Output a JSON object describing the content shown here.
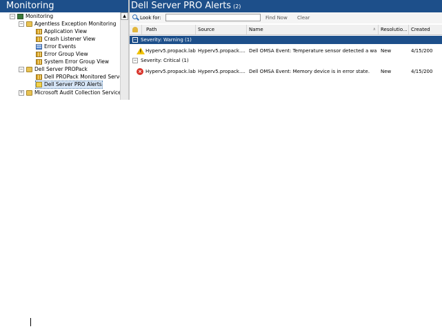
{
  "left_pane": {
    "title": "Monitoring",
    "tree": [
      {
        "label": "Monitoring",
        "indent": 0,
        "expander": "−",
        "icon": "monitor-icon"
      },
      {
        "label": "Agentless Exception Monitoring",
        "indent": 1,
        "expander": "−",
        "icon": "folder-icon"
      },
      {
        "label": "Application View",
        "indent": 2,
        "expander": "",
        "icon": "grid-icon"
      },
      {
        "label": "Crash Listener View",
        "indent": 2,
        "expander": "",
        "icon": "grid-icon"
      },
      {
        "label": "Error Events",
        "indent": 2,
        "expander": "",
        "icon": "events-icon"
      },
      {
        "label": "Error Group View",
        "indent": 2,
        "expander": "",
        "icon": "grid-icon"
      },
      {
        "label": "System Error Group View",
        "indent": 2,
        "expander": "",
        "icon": "grid-icon"
      },
      {
        "label": "Dell Server PROPack",
        "indent": 1,
        "expander": "−",
        "icon": "folder-icon"
      },
      {
        "label": "Dell PROPack Monitored Servers",
        "indent": 2,
        "expander": "",
        "icon": "grid-icon"
      },
      {
        "label": "Dell Server PRO Alerts",
        "indent": 2,
        "expander": "",
        "icon": "alert-view-icon",
        "selected": true
      },
      {
        "label": "Microsoft Audit Collection Services",
        "indent": 1,
        "expander": "+",
        "icon": "folder-icon"
      }
    ]
  },
  "right_pane": {
    "title": "Dell Server PRO Alerts",
    "count": "(2)",
    "toolbar": {
      "look_for_label": "Look for:",
      "search_value": "",
      "find_now": "Find Now",
      "clear": "Clear"
    },
    "columns": [
      "",
      "Path",
      "Source",
      "Name",
      "Resolutio...",
      "Created"
    ],
    "groups": [
      {
        "label": "Severity: Warning (1)",
        "rows": [
          {
            "severity": "warning",
            "path": "Hyperv5.propack.lab",
            "source": "Hyperv5.propack....",
            "name": "Dell OMSA Event: Temperature sensor detected a wa...",
            "resolution": "New",
            "created": "4/15/200"
          }
        ]
      },
      {
        "label": "Severity: Critical (1)",
        "rows": [
          {
            "severity": "critical",
            "path": "Hyperv5.propack.lab",
            "source": "Hyperv5.propack....",
            "name": "Dell OMSA Event: Memory device is in error state.",
            "resolution": "New",
            "created": "4/15/200"
          }
        ]
      }
    ]
  },
  "colors": {
    "header_blue": "#1d4f8a",
    "selection": "#d7e6f7",
    "critical_red": "#d9342b",
    "warning_yellow": "#f2c200"
  }
}
